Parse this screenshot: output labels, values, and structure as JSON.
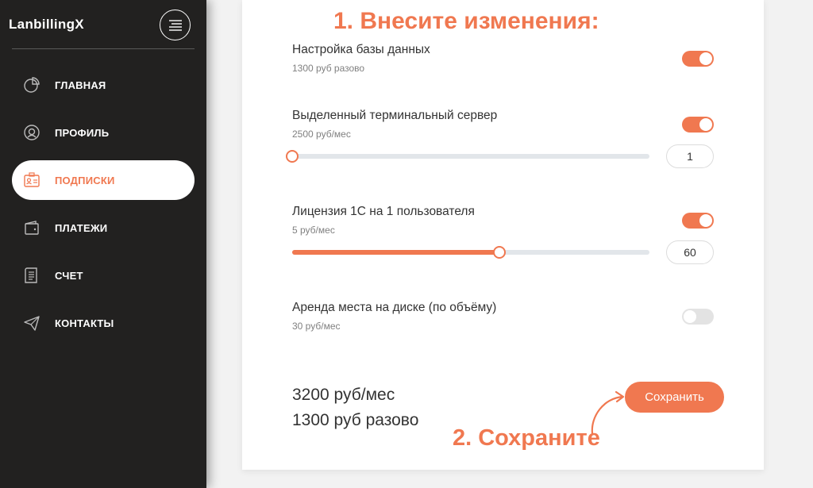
{
  "app": {
    "title": "LanbillingX"
  },
  "colors": {
    "accent": "#f07850",
    "sidebar": "#222120",
    "track": "#e2e6ea"
  },
  "sidebar": {
    "items": [
      {
        "label": "ГЛАВНАЯ",
        "icon": "pie-chart-icon",
        "active": false
      },
      {
        "label": "ПРОФИЛЬ",
        "icon": "user-circle-icon",
        "active": false
      },
      {
        "label": "ПОДПИСКИ",
        "icon": "id-card-icon",
        "active": true
      },
      {
        "label": "ПЛАТЕЖИ",
        "icon": "wallet-icon",
        "active": false
      },
      {
        "label": "СЧЕТ",
        "icon": "receipt-icon",
        "active": false
      },
      {
        "label": "КОНТАКТЫ",
        "icon": "paper-plane-icon",
        "active": false
      }
    ]
  },
  "annotations": {
    "step1": "1. Внесите изменения:",
    "step2": "2. Сохраните"
  },
  "services": [
    {
      "title": "Настройка базы данных",
      "price": "1300 руб разово",
      "enabled": true
    },
    {
      "title": "Выделенный терминальный сервер",
      "price": "2500 руб/мес",
      "enabled": true,
      "quantity": "1",
      "slider_fraction": 0.0
    },
    {
      "title": "Лицензия 1С на 1 пользователя",
      "price": "5 руб/мес",
      "enabled": true,
      "quantity": "60",
      "slider_fraction": 0.58
    },
    {
      "title": "Аренда места на диске (по объёму)",
      "price": "30 руб/мес",
      "enabled": false
    }
  ],
  "totals": {
    "monthly": "3200 руб/мес",
    "one_time": "1300 руб разово"
  },
  "actions": {
    "save_label": "Сохранить"
  }
}
